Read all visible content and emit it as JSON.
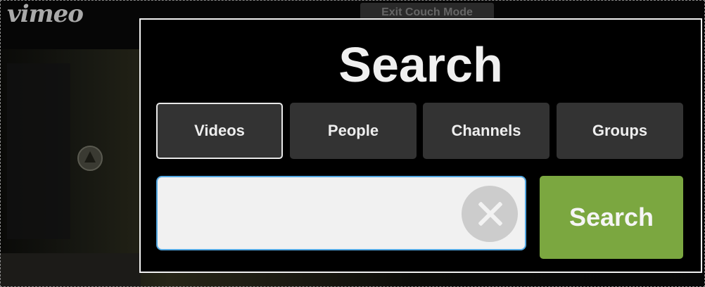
{
  "app": {
    "logo_text": "vimeo",
    "couch_mode_label": "Exit Couch Mode"
  },
  "dialog": {
    "title": "Search",
    "tabs": [
      {
        "label": "Videos",
        "selected": true
      },
      {
        "label": "People",
        "selected": false
      },
      {
        "label": "Channels",
        "selected": false
      },
      {
        "label": "Groups",
        "selected": false
      }
    ],
    "query": {
      "value": "",
      "placeholder": ""
    },
    "clear_icon": "close-icon",
    "search_button_label": "Search"
  },
  "colors": {
    "accent_green": "#7ba740",
    "input_focus_border": "#53a8e2",
    "tab_bg": "#333333",
    "dialog_bg": "#000000"
  }
}
